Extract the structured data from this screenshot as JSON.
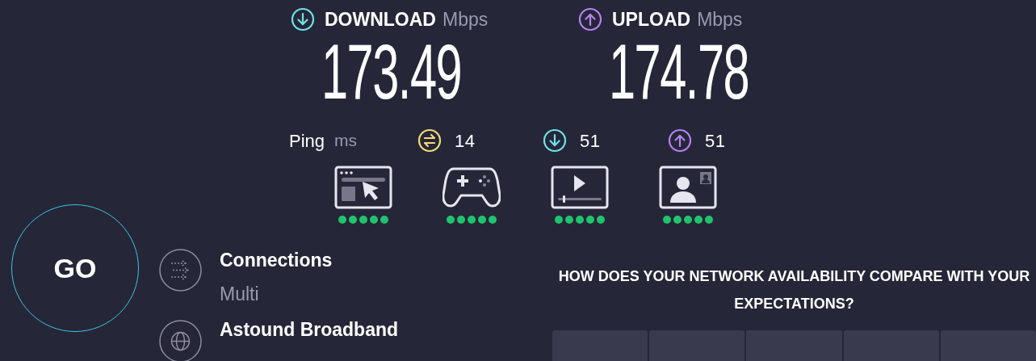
{
  "download": {
    "label": "DOWNLOAD",
    "unit": "Mbps",
    "value": "173.49"
  },
  "upload": {
    "label": "UPLOAD",
    "unit": "Mbps",
    "value": "174.78"
  },
  "ping": {
    "label": "Ping",
    "unit": "ms",
    "readings": [
      {
        "kind": "idle",
        "value": "14"
      },
      {
        "kind": "download",
        "value": "51"
      },
      {
        "kind": "upload",
        "value": "51"
      }
    ]
  },
  "activities": [
    {
      "kind": "browsing",
      "stars": 5
    },
    {
      "kind": "gaming",
      "stars": 5
    },
    {
      "kind": "streaming",
      "stars": 5
    },
    {
      "kind": "video_call",
      "stars": 5
    }
  ],
  "go_button": "GO",
  "connections": {
    "label": "Connections",
    "value": "Multi"
  },
  "provider": {
    "name": "Astound Broadband"
  },
  "survey": {
    "question": "HOW DOES YOUR NETWORK AVAILABILITY COMPARE WITH YOUR EXPECTATIONS?"
  }
}
